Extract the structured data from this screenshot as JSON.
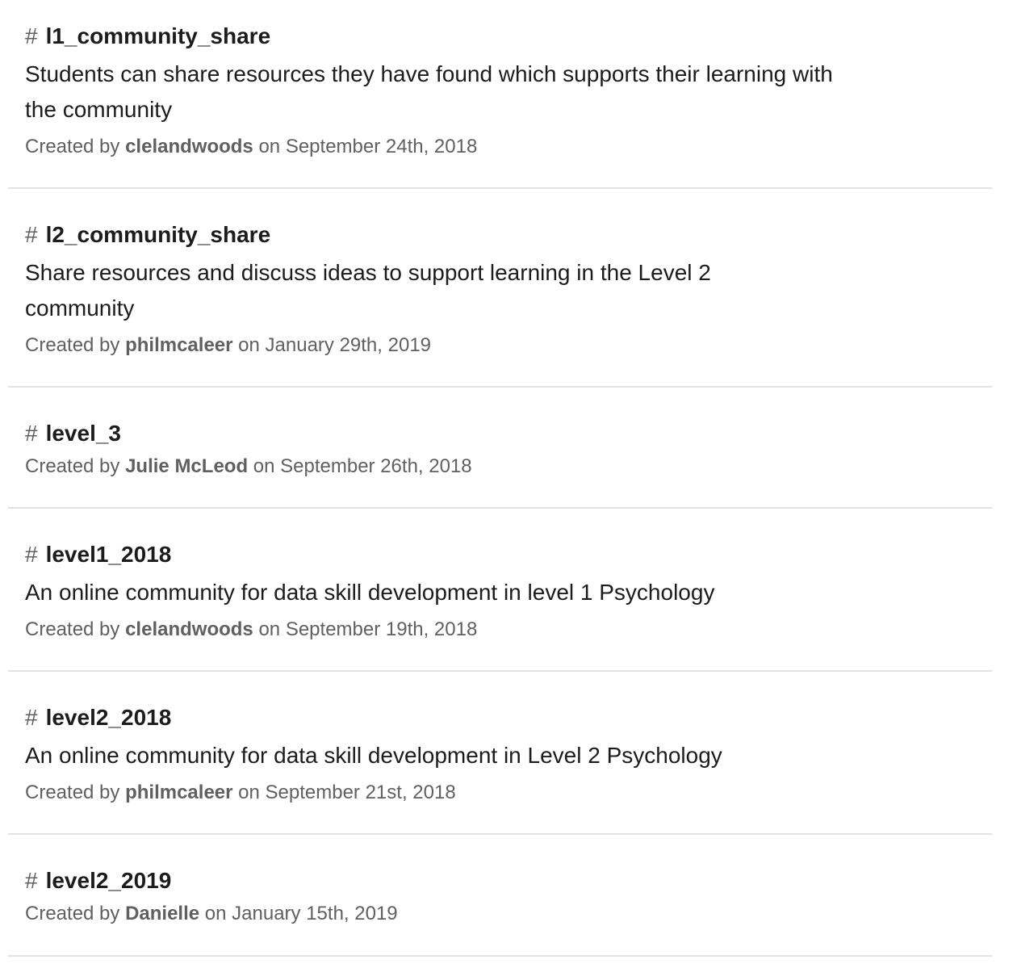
{
  "channels": [
    {
      "hash": "#",
      "name": "l1_community_share",
      "purpose": "Students can share resources they have found which supports their learning with the community",
      "created_prefix": "Created by",
      "creator": "clelandwoods",
      "created_on": "on September 24th, 2018"
    },
    {
      "hash": "#",
      "name": "l2_community_share",
      "purpose": "Share resources and discuss ideas to support learning in the Level 2 community",
      "created_prefix": "Created by",
      "creator": "philmcaleer",
      "created_on": "on January 29th, 2019"
    },
    {
      "hash": "#",
      "name": "level_3",
      "purpose": "",
      "created_prefix": "Created by",
      "creator": "Julie McLeod",
      "created_on": "on September 26th, 2018"
    },
    {
      "hash": "#",
      "name": "level1_2018",
      "purpose": "An online community for data skill development in level 1 Psychology",
      "created_prefix": "Created by",
      "creator": "clelandwoods",
      "created_on": "on September 19th, 2018"
    },
    {
      "hash": "#",
      "name": "level2_2018",
      "purpose": "An online community for data skill development in Level 2 Psychology",
      "created_prefix": "Created by",
      "creator": "philmcaleer",
      "created_on": "on September 21st, 2018"
    },
    {
      "hash": "#",
      "name": "level2_2019",
      "purpose": "",
      "created_prefix": "Created by",
      "creator": "Danielle",
      "created_on": "on January 15th, 2019"
    }
  ]
}
